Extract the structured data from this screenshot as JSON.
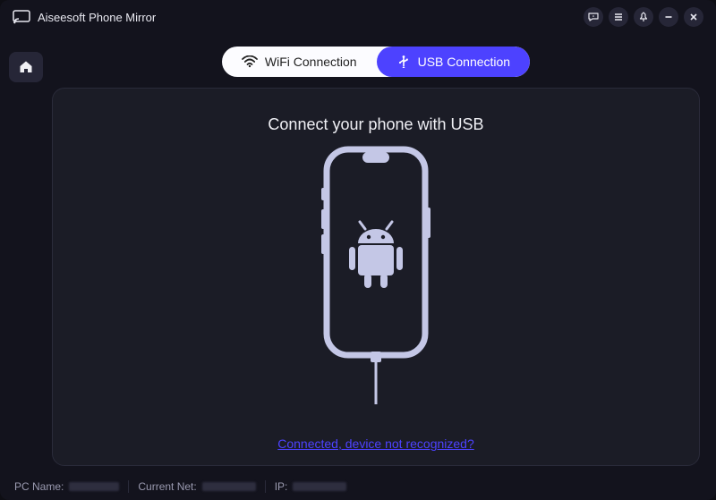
{
  "app": {
    "title": "Aiseesoft Phone Mirror"
  },
  "tabs": {
    "wifi": "WiFi Connection",
    "usb": "USB Connection"
  },
  "content": {
    "instruction": "Connect your phone with USB",
    "help_link": "Connected, device not recognized?"
  },
  "status": {
    "pc_name_label": "PC Name:",
    "current_net_label": "Current Net:",
    "ip_label": "IP:"
  },
  "colors": {
    "accent": "#4d42ff",
    "phone": "#c4c7e6"
  }
}
